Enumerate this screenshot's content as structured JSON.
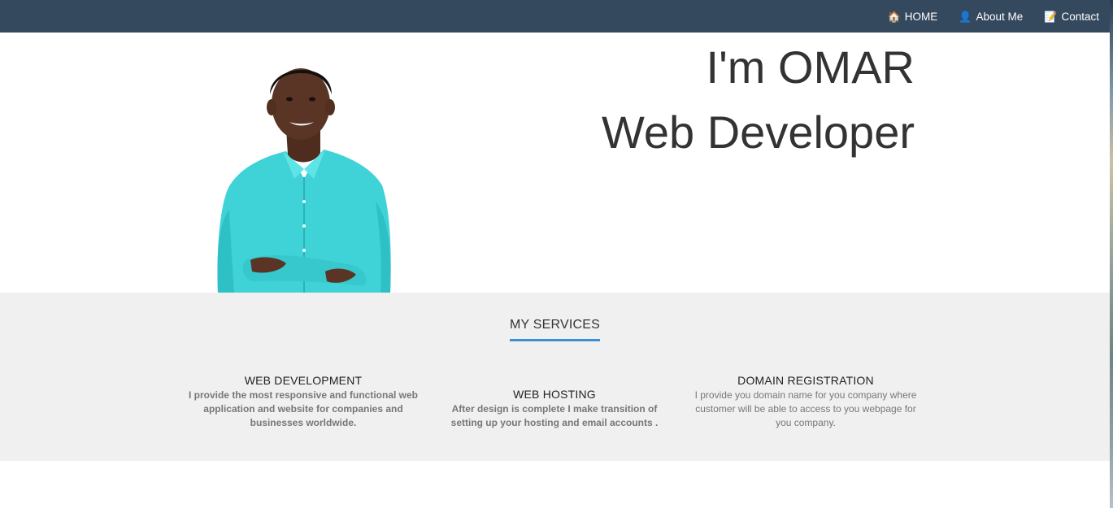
{
  "nav": {
    "items": [
      {
        "icon": "house-icon",
        "glyph": "🏠",
        "label": "HOME"
      },
      {
        "icon": "person-icon",
        "glyph": "👤",
        "label": "About Me"
      },
      {
        "icon": "memo-icon",
        "glyph": "📝",
        "label": "Contact"
      }
    ]
  },
  "hero": {
    "title": "I'm OMAR",
    "subtitle": "Web Developer",
    "portrait_alt": "portrait-photo"
  },
  "services": {
    "heading": "MY SERVICES",
    "items": [
      {
        "title": "WEB DEVELOPMENT",
        "description": "I provide the most responsive and functional web application and website for companies and businesses worldwide."
      },
      {
        "title": "WEB HOSTING",
        "description": "After design is complete I make transition of setting up your hosting and email accounts ."
      },
      {
        "title": "DOMAIN REGISTRATION",
        "description": "I provide you domain name for you company where customer will be able to access to you webpage for you company."
      }
    ]
  },
  "colors": {
    "navbar": "#34495e",
    "accent": "#3a8fd6",
    "services_bg": "#f0f0f0",
    "text_dark": "#333333"
  }
}
